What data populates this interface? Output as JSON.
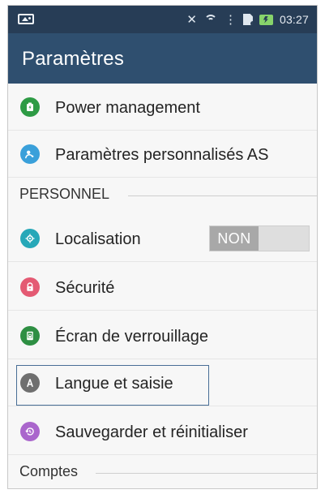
{
  "status_bar": {
    "time": "03:27",
    "icons": [
      "image-icon",
      "mute-icon",
      "wifi-icon",
      "sim-icon",
      "battery-charging-icon"
    ]
  },
  "header": {
    "title": "Paramètres"
  },
  "colors": {
    "status_bar": "#273d56",
    "header": "#2f4f6f",
    "background": "#f7f7f7",
    "focus_outline": "#486e96",
    "power_icon": "#2e9b45",
    "asus_icon": "#3aa0da",
    "location_icon": "#27a8b8",
    "security_icon": "#e45a73",
    "lock_icon": "#2e8f43",
    "language_icon": "#6f6f6f",
    "backup_icon": "#aa66cc"
  },
  "sections": [
    {
      "items": [
        {
          "label": "Power management",
          "icon": "power-management-icon"
        },
        {
          "label": "Paramètres personnalisés AS",
          "icon": "asus-custom-settings-icon"
        }
      ]
    },
    {
      "title": "PERSONNEL",
      "items": [
        {
          "label": "Localisation",
          "icon": "location-icon",
          "toggle": "NON"
        },
        {
          "label": "Sécurité",
          "icon": "security-lock-icon"
        },
        {
          "label": "Écran de verrouillage",
          "icon": "lock-screen-icon"
        },
        {
          "label": "Langue et saisie",
          "icon": "language-input-icon",
          "focused": true
        },
        {
          "label": "Sauvegarder et réinitialiser",
          "icon": "backup-reset-icon"
        }
      ]
    },
    {
      "title": "Comptes",
      "items": []
    }
  ]
}
